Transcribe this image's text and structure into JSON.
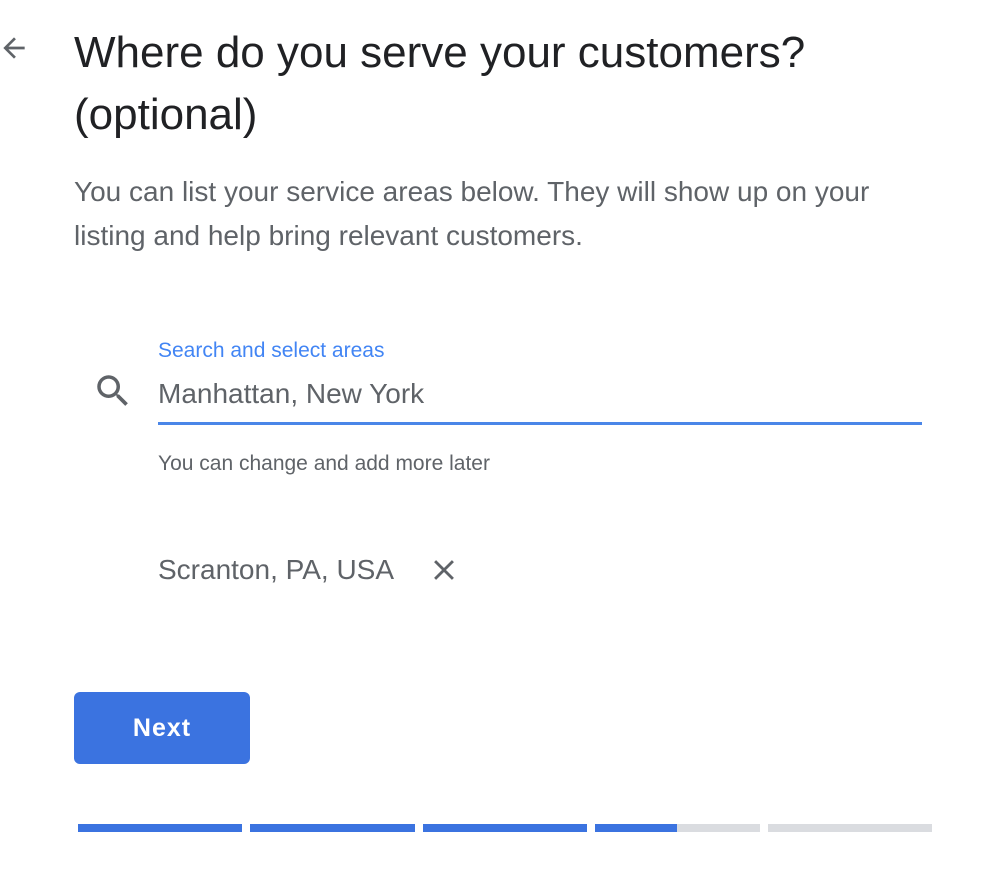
{
  "header": {
    "back_icon": "arrow-left-icon",
    "title": "Where do you serve your customers? (optional)",
    "subtitle": "You can list your service areas below. They will show up on your listing and help bring relevant customers."
  },
  "search": {
    "icon": "search-icon",
    "label": "Search and select areas",
    "value": "Manhattan, New York",
    "helper": "You can change and add more later"
  },
  "selected_areas": [
    {
      "label": "Scranton, PA, USA",
      "remove_icon": "close-icon"
    }
  ],
  "actions": {
    "next_label": "Next"
  },
  "progress": {
    "segments": [
      1,
      1,
      1,
      0.5,
      0
    ],
    "color_done": "#3b73e0",
    "color_todo": "#dadce0"
  },
  "colors": {
    "accent": "#4285f4",
    "primary_button": "#3b73e0",
    "title_text": "#202124",
    "secondary_text": "#5f6368"
  }
}
